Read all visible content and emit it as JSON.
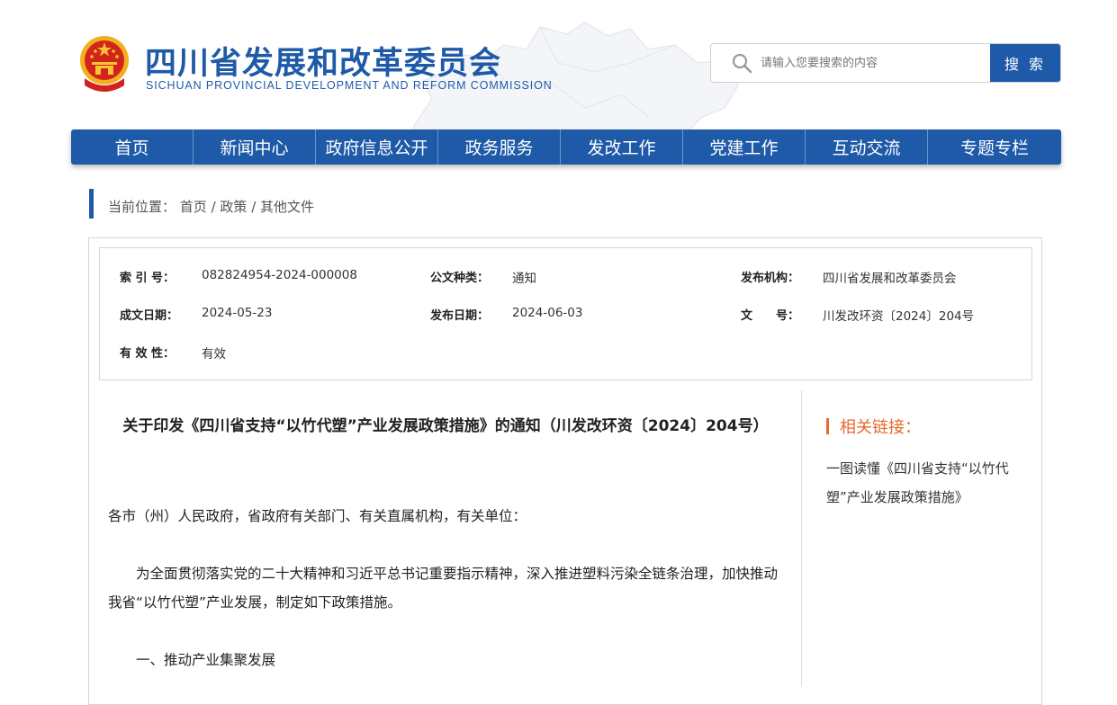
{
  "header": {
    "title": "四川省发展和改革委员会",
    "subtitle": "SICHUAN PROVINCIAL DEVELOPMENT AND REFORM COMMISSION",
    "search_placeholder": "请输入您要搜索的内容",
    "search_button": "搜 索"
  },
  "nav": [
    "首页",
    "新闻中心",
    "政府信息公开",
    "政务服务",
    "发改工作",
    "党建工作",
    "互动交流",
    "专题专栏"
  ],
  "breadcrumb": {
    "label": "当前位置：",
    "items": [
      "首页",
      "政策",
      "其他文件"
    ],
    "separator": " / "
  },
  "meta": {
    "index_label": "索 引 号：",
    "index_value": "082824954-2024-000008",
    "type_label": "公文种类：",
    "type_value": "通知",
    "org_label": "发布机构：",
    "org_value": "四川省发展和改革委员会",
    "date_created_label": "成文日期：",
    "date_created_value": "2024-05-23",
    "date_published_label": "发布日期：",
    "date_published_value": "2024-06-03",
    "doc_no_label": "文　　号：",
    "doc_no_value": "川发改环资〔2024〕204号",
    "validity_label": "有 效 性：",
    "validity_value": "有效"
  },
  "article": {
    "title": "关于印发《四川省支持“以竹代塑”产业发展政策措施》的通知（川发改环资〔2024〕204号）",
    "salutation": "各市（州）人民政府，省政府有关部门、有关直属机构，有关单位：",
    "intro": "为全面贯彻落实党的二十大精神和习近平总书记重要指示精神，深入推进塑料污染全链条治理，加快推动我省“以竹代塑”产业发展，制定如下政策措施。",
    "section1": "一、推动产业集聚发展"
  },
  "related": {
    "title": "相关链接：",
    "links": [
      "一图读懂《四川省支持“以竹代塑”产业发展政策措施》"
    ]
  },
  "colors": {
    "brand_blue": "#1e5aa8",
    "accent_orange": "#e8692c"
  }
}
